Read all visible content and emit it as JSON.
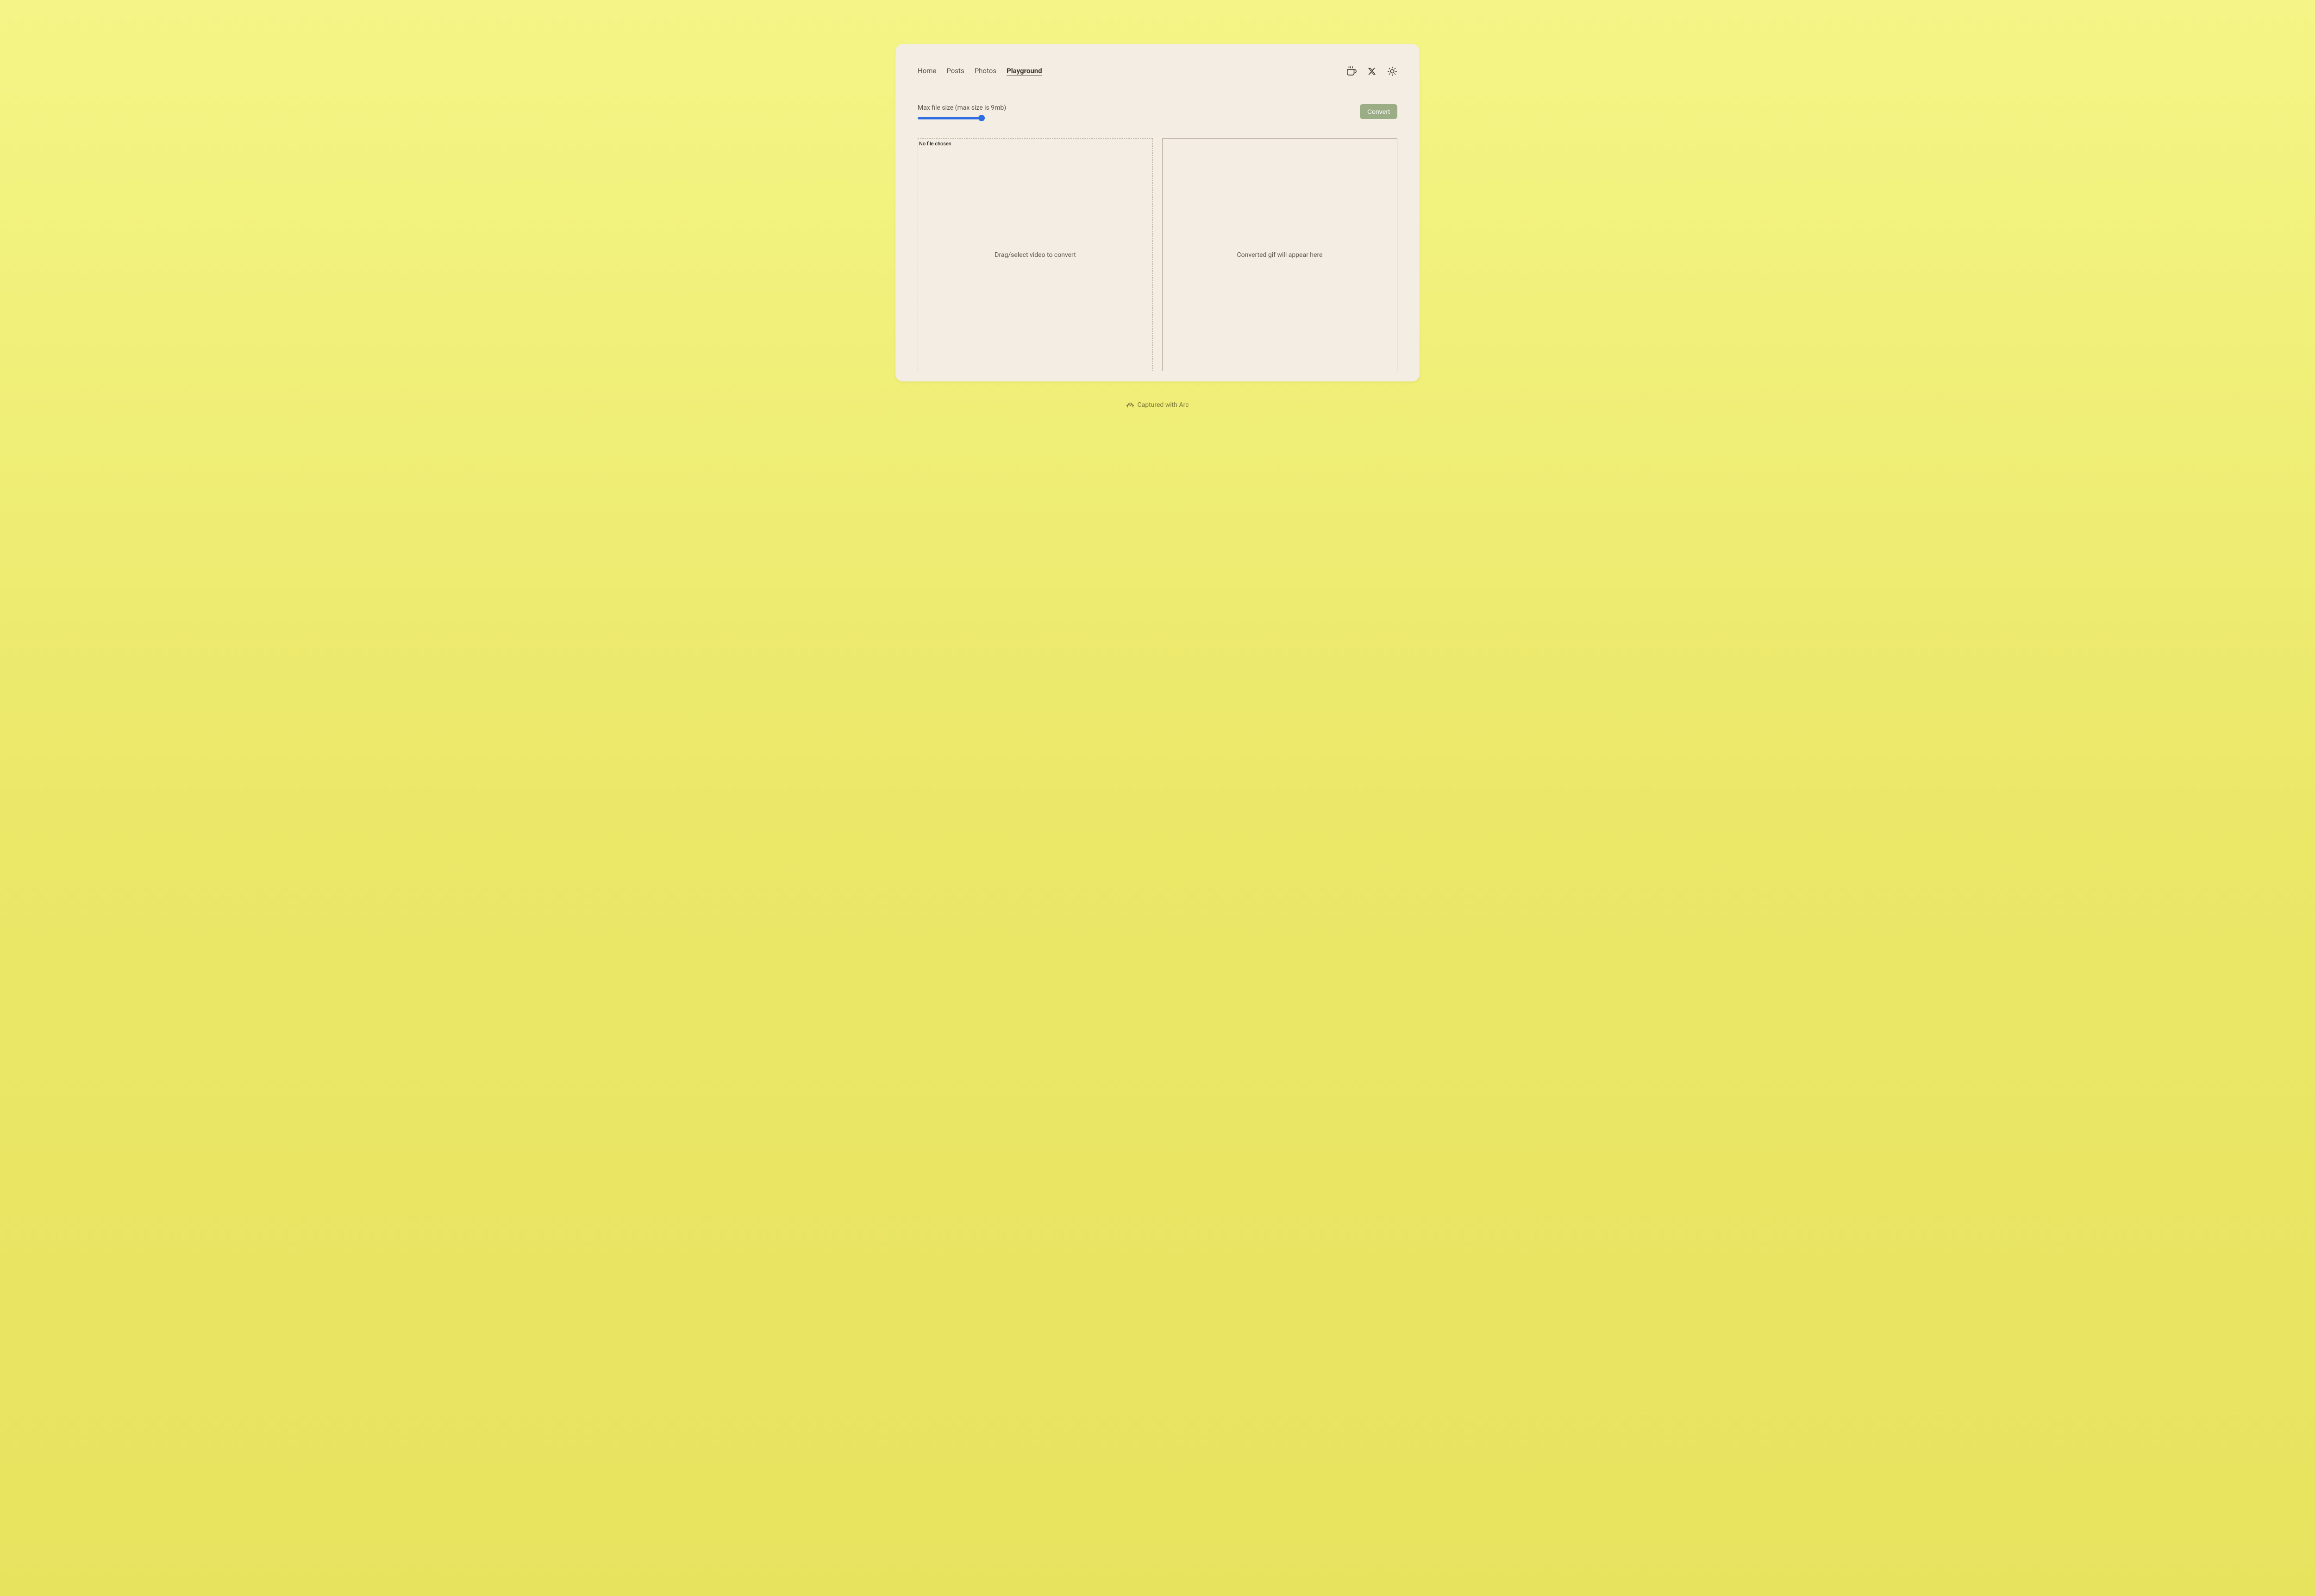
{
  "nav": {
    "items": [
      {
        "label": "Home",
        "active": false
      },
      {
        "label": "Posts",
        "active": false
      },
      {
        "label": "Photos",
        "active": false
      },
      {
        "label": "Playground",
        "active": true
      }
    ]
  },
  "controls": {
    "slider_label": "Max file size (max size is 9mb)",
    "convert_label": "Convert"
  },
  "panels": {
    "file_status": "No file chosen",
    "left_placeholder": "Drag/select video to convert",
    "right_placeholder": "Converted gif will appear here"
  },
  "footer": {
    "text": "Captured with Arc"
  }
}
